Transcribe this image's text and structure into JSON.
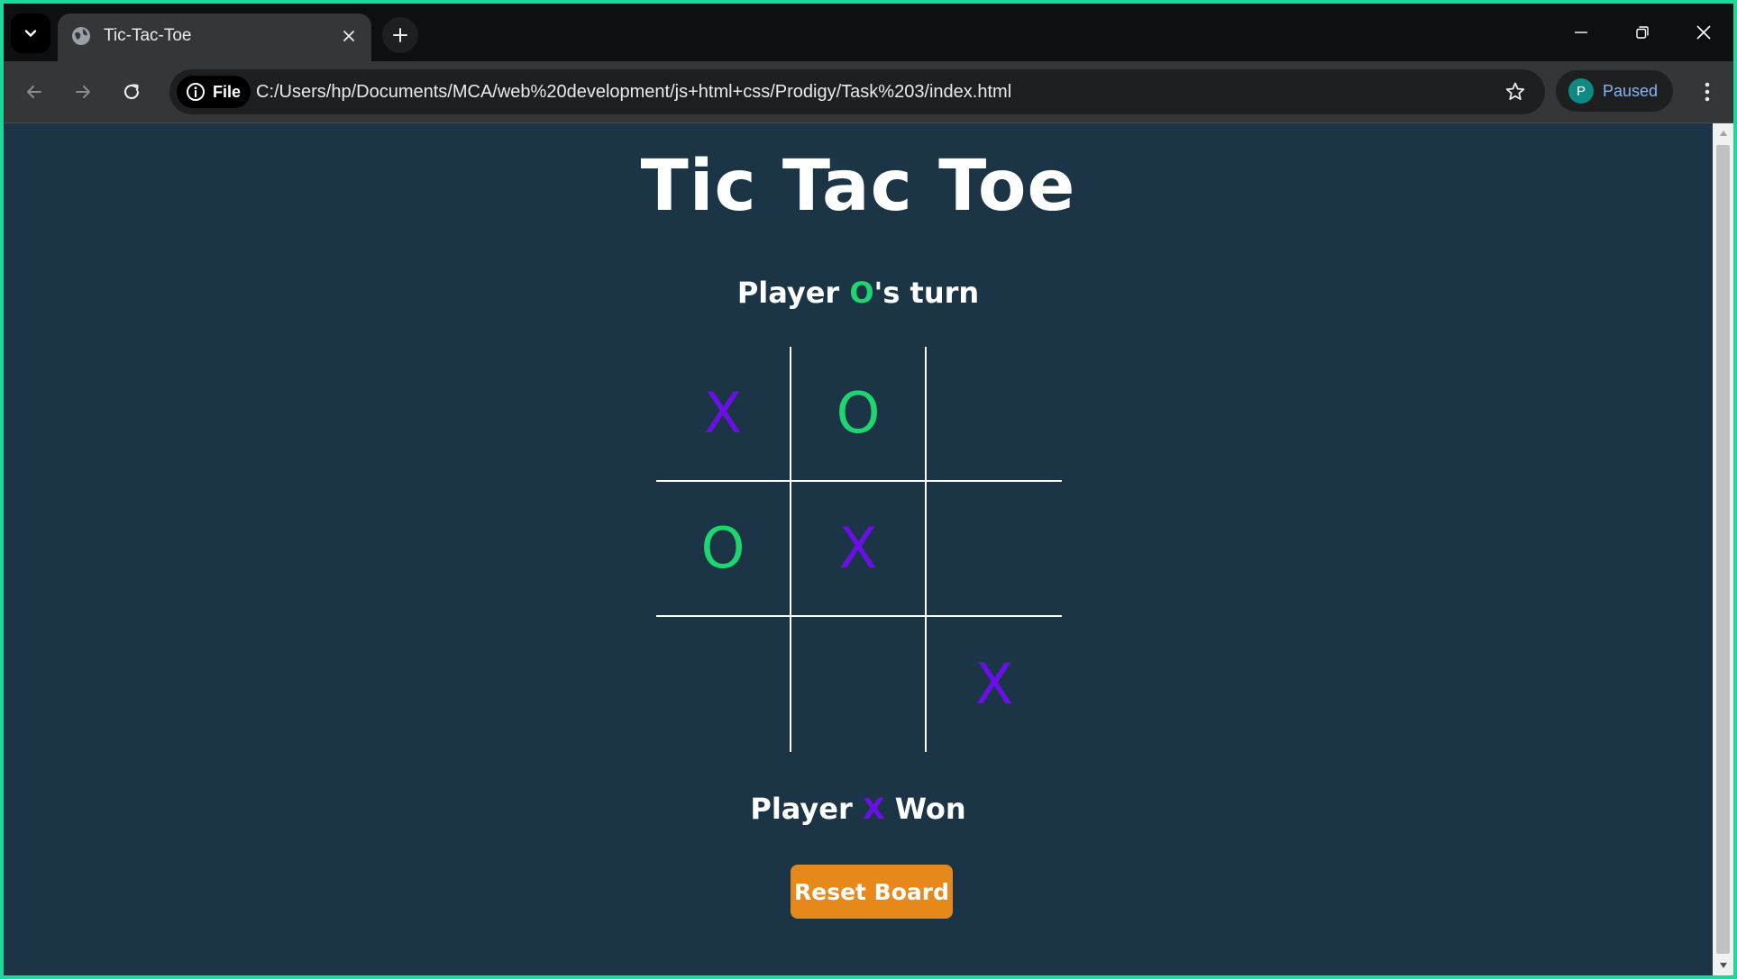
{
  "browser": {
    "tab": {
      "title": "Tic-Tac-Toe"
    },
    "address_bar": {
      "site_chip_label": "File",
      "url": "C:/Users/hp/Documents/MCA/web%20development/js+html+css/Prodigy/Task%203/index.html"
    },
    "profile": {
      "initial": "P",
      "status": "Paused"
    }
  },
  "page": {
    "heading": "Tic Tac Toe",
    "turn": {
      "prefix": "Player ",
      "symbol": "O",
      "suffix": "'s turn"
    },
    "board": {
      "cells": [
        "X",
        "O",
        "",
        "O",
        "X",
        "",
        "",
        "",
        "X"
      ]
    },
    "result": {
      "prefix": "Player ",
      "symbol": "X",
      "suffix": " Won"
    },
    "reset_label": "Reset Board"
  },
  "colors": {
    "x": "#6a10e6",
    "o": "#1fd56f",
    "background": "#1b3546",
    "reset_button": "#e7881a"
  }
}
